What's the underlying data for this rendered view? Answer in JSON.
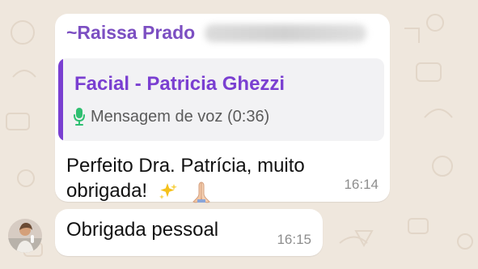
{
  "messages": [
    {
      "sender": "~Raissa Prado",
      "reply": {
        "title": "Facial - Patricia Ghezzi",
        "subtitle": "Mensagem de voz (0:36)"
      },
      "text_line1": "Perfeito Dra. Patrícia, muito",
      "text_line2": "obrigada!",
      "time": "16:14",
      "emoji": [
        "sparkles-icon",
        "praying-hands-icon"
      ]
    },
    {
      "text": "Obrigada pessoal",
      "time": "16:15"
    }
  ],
  "colors": {
    "background": "#efe7dd",
    "bubble": "#ffffff",
    "sender": "#7c4fc2",
    "quote_accent": "#7a3fd1",
    "mic": "#2fbf71"
  }
}
